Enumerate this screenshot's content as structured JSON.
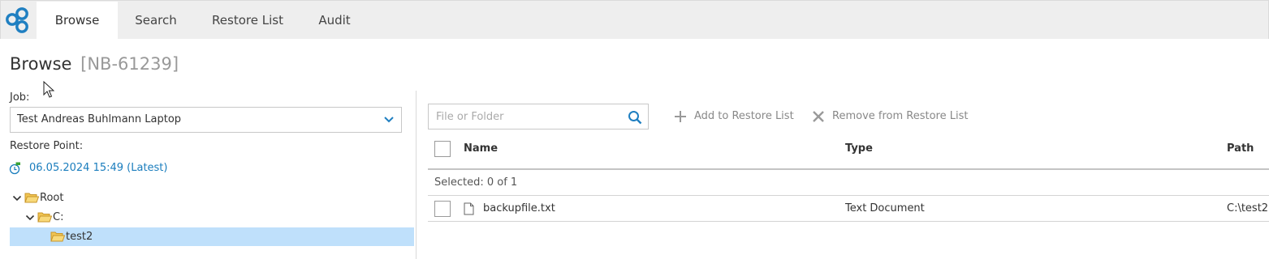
{
  "nav": {
    "tabs": [
      {
        "label": "Browse",
        "active": true
      },
      {
        "label": "Search",
        "active": false
      },
      {
        "label": "Restore List",
        "active": false
      },
      {
        "label": "Audit",
        "active": false
      }
    ]
  },
  "page": {
    "title": "Browse",
    "job_id": "[NB-61239]"
  },
  "left": {
    "job_label": "Job:",
    "job_value": "Test Andreas Buhlmann Laptop",
    "restore_point_label": "Restore Point:",
    "restore_point_value": "06.05.2024 15:49 (Latest)",
    "tree": [
      {
        "label": "Root",
        "expanded": true,
        "selected": false
      },
      {
        "label": "C:",
        "expanded": true,
        "selected": false
      },
      {
        "label": "test2",
        "expanded": false,
        "selected": true
      }
    ]
  },
  "right": {
    "search_placeholder": "File or Folder",
    "add_label": "Add to Restore List",
    "remove_label": "Remove from Restore List",
    "columns": {
      "name": "Name",
      "type": "Type",
      "path": "Path"
    },
    "selected_text": "Selected: 0 of 1",
    "rows": [
      {
        "name": "backupfile.txt",
        "type": "Text Document",
        "path": "C:\\test2"
      }
    ]
  },
  "colors": {
    "accent": "#1a7dbd",
    "selected_row": "#bfe0fb",
    "nav_background": "#eeeeee",
    "restore_point_flag": "#3aa335"
  }
}
